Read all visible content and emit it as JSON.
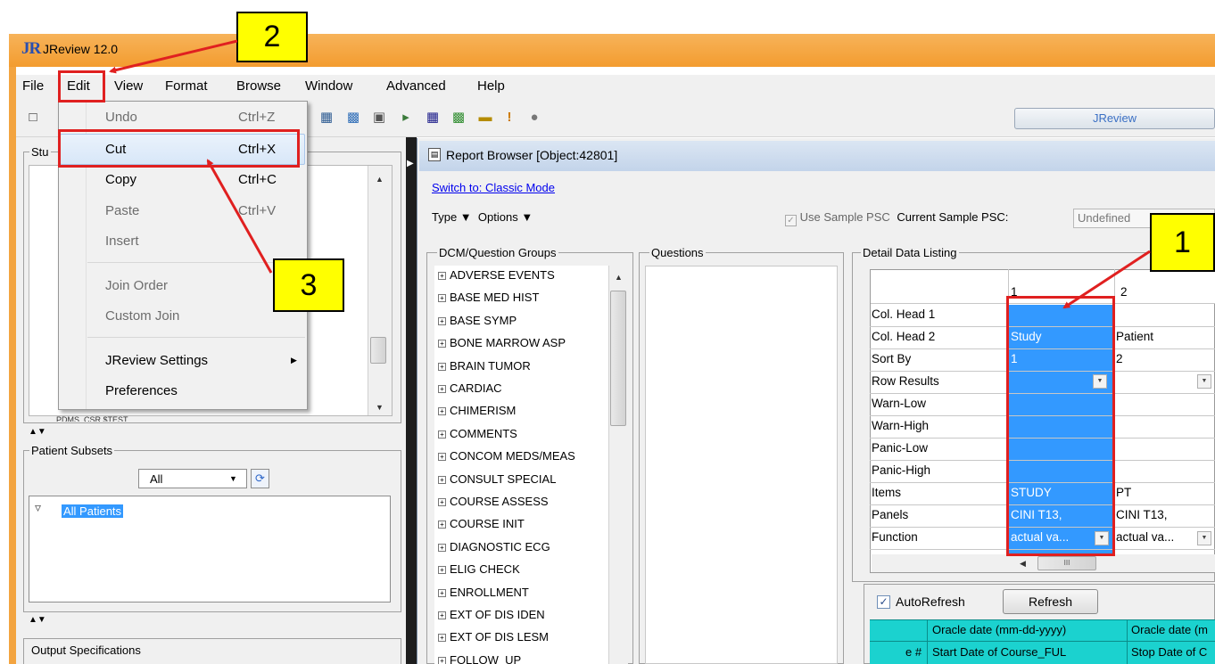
{
  "window": {
    "logo": "JR",
    "title": "JReview 12.0"
  },
  "menubar": [
    "File",
    "Edit",
    "View",
    "Format",
    "Browse",
    "Window",
    "Advanced",
    "Help"
  ],
  "toolbar": {
    "jreview_button": "JReview"
  },
  "edit_menu": {
    "undo": {
      "label": "Undo",
      "shortcut": "Ctrl+Z"
    },
    "cut": {
      "label": "Cut",
      "shortcut": "Ctrl+X"
    },
    "copy": {
      "label": "Copy",
      "shortcut": "Ctrl+C"
    },
    "paste": {
      "label": "Paste",
      "shortcut": "Ctrl+V"
    },
    "insert": "Insert",
    "join_order": "Join Order",
    "custom_join": "Custom Join",
    "settings": "JReview Settings",
    "preferences": "Preferences"
  },
  "left": {
    "study_label": "Stu",
    "study_tree_partial": "PDMS_CSR $TEST",
    "subsets_label": "Patient Subsets",
    "subset_select": "All",
    "all_patients": "All Patients",
    "output_label": "Output Specifications"
  },
  "report_browser": {
    "title": "Report Browser [Object:42801]",
    "switch_link": "Switch to: Classic Mode",
    "type_label": "Type ▼",
    "options_label": "Options ▼",
    "use_sample": "Use Sample PSC",
    "current_sample_label": "Current Sample PSC:",
    "current_sample_value": "Undefined",
    "groups_label": "DCM/Question Groups",
    "questions_label": "Questions",
    "detail_label": "Detail Data Listing",
    "groups": [
      "ADVERSE EVENTS",
      "BASE MED HIST",
      "BASE SYMP",
      "BONE MARROW ASP",
      "BRAIN TUMOR",
      "CARDIAC",
      "CHIMERISM",
      "COMMENTS",
      "CONCOM MEDS/MEAS",
      "CONSULT SPECIAL",
      "COURSE ASSESS",
      "COURSE INIT",
      "DIAGNOSTIC ECG",
      "ELIG CHECK",
      "ENROLLMENT",
      "EXT OF DIS IDEN",
      "EXT OF DIS LESM",
      "FOLLOW_UP"
    ]
  },
  "grid": {
    "col_headers": [
      "1",
      "2"
    ],
    "rows": [
      {
        "label": "Col. Head 1",
        "c1": "",
        "c2": ""
      },
      {
        "label": "Col. Head 2",
        "c1": "Study",
        "c2": "Patient"
      },
      {
        "label": "Sort By",
        "c1": "1",
        "c2": "2"
      },
      {
        "label": "Row Results",
        "c1": "",
        "c2": ""
      },
      {
        "label": "Warn-Low",
        "c1": "",
        "c2": ""
      },
      {
        "label": "Warn-High",
        "c1": "",
        "c2": ""
      },
      {
        "label": "Panic-Low",
        "c1": "",
        "c2": ""
      },
      {
        "label": "Panic-High",
        "c1": "",
        "c2": ""
      },
      {
        "label": "Items",
        "c1": "STUDY",
        "c2": "PT"
      },
      {
        "label": "Panels",
        "c1": "CINI T13,",
        "c2": "CINI T13,"
      },
      {
        "label": "Function",
        "c1": "actual va...",
        "c2": "actual va..."
      }
    ],
    "scroll_glyph": "III"
  },
  "results": {
    "autorefresh": "AutoRefresh",
    "refresh": "Refresh",
    "head_row1": [
      "Oracle date (mm-dd-yyyy)",
      "Oracle date (m"
    ],
    "head_row2": [
      "e #",
      "Start Date of Course_FUL",
      "Stop Date of C"
    ]
  },
  "annotations": {
    "callout1": "1",
    "callout2": "2",
    "callout3": "3",
    "color": "#e02020",
    "callout_bg": "#ffff00"
  }
}
